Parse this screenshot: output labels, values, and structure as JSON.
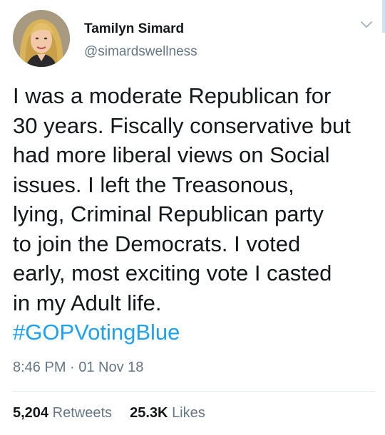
{
  "author": {
    "display_name": "Tamilyn Simard",
    "handle": "@simardswellness",
    "avatar_icon": "profile-photo"
  },
  "tweet": {
    "lines": [
      "I was a moderate Republican for",
      "30 years. Fiscally conservative but",
      "had more liberal views on Social",
      "issues. I left the Treasonous,",
      "lying, Criminal Republican party",
      "to join the Democrats. I voted",
      "early, most exciting vote I casted",
      "in my Adult life."
    ],
    "hashtag": "#GOPVotingBlue",
    "timestamp": "8:46 PM · 01 Nov 18"
  },
  "stats": {
    "retweets_count": "5,204",
    "retweets_label": "Retweets",
    "likes_count": "25.3K",
    "likes_label": "Likes"
  },
  "colors": {
    "link": "#1da1f2",
    "secondary_text": "#657786",
    "primary_text": "#14171a"
  }
}
